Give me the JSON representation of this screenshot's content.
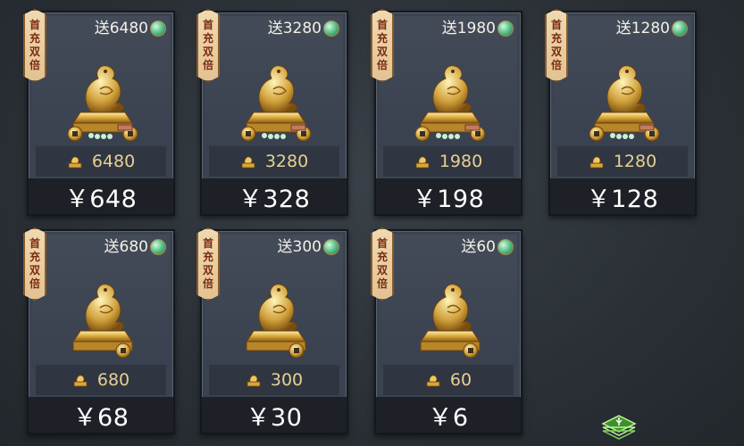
{
  "ribbon_lines": [
    "首",
    "充",
    "双",
    "倍"
  ],
  "cards": [
    {
      "bonus": "送6480",
      "amount": "6480",
      "price": "￥648"
    },
    {
      "bonus": "送3280",
      "amount": "3280",
      "price": "￥328"
    },
    {
      "bonus": "送1980",
      "amount": "1980",
      "price": "￥198"
    },
    {
      "bonus": "送1280",
      "amount": "1280",
      "price": "￥128"
    },
    {
      "bonus": "送680",
      "amount": "680",
      "price": "￥68"
    },
    {
      "bonus": "送300",
      "amount": "300",
      "price": "￥30"
    },
    {
      "bonus": "送60",
      "amount": "60",
      "price": "￥6"
    }
  ],
  "colors": {
    "gold": "#e7cf93",
    "ribbon": "#f0d9b0",
    "ribbon_text": "#7a2a12",
    "gem": "#5fc78f"
  },
  "icons": {
    "bonus": "jade-gem-icon",
    "amount": "gold-seal-icon",
    "main_art": "gold-dragon-seal-icon"
  }
}
